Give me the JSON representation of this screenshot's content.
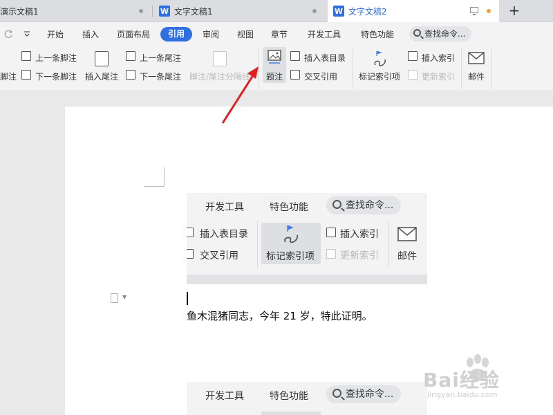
{
  "tabs": [
    {
      "label": "演示文稿1",
      "active": false
    },
    {
      "label": "文字文稿1",
      "active": false,
      "icon": "W"
    },
    {
      "label": "文字文稿2",
      "active": true,
      "icon": "W"
    }
  ],
  "new_tab": "+",
  "menu": {
    "items": [
      "开始",
      "插入",
      "页面布局",
      "引用",
      "审阅",
      "视图",
      "章节",
      "开发工具",
      "特色功能"
    ],
    "active": "引用",
    "search": "查找命令..."
  },
  "ribbon": {
    "footnote_partial": "脚注",
    "prev_footnote": "上一条脚注",
    "next_footnote": "下一条脚注",
    "insert_endnote": "插入尾注",
    "prev_endnote": "上一条尾注",
    "next_endnote": "下一条尾注",
    "separator": "脚注/尾注分隔线",
    "caption": "题注",
    "insert_toc": "插入表目录",
    "cross_ref": "交叉引用",
    "mark_index": "标记索引项",
    "insert_index": "插入索引",
    "update_index": "更新索引",
    "mail": "邮件"
  },
  "doc": {
    "shot1": {
      "dev_tools": "开发工具",
      "features": "特色功能",
      "search": "查找命令...",
      "insert_toc": "插入表目录",
      "cross_ref": "交叉引用",
      "mark_index": "标记索引项",
      "insert_index": "插入索引",
      "update_index": "更新索引",
      "mail": "邮件"
    },
    "body_text": "鱼木混猪同志，今年 21 岁，特此证明。",
    "shot2": {
      "dev_tools": "开发工具",
      "features": "特色功能",
      "search": "查找命令..."
    }
  },
  "watermark": {
    "main": "Bai经验",
    "sub": "jingyan.baidu.com"
  },
  "colors": {
    "accent": "#2f6fe1",
    "arrow": "#e02020"
  }
}
